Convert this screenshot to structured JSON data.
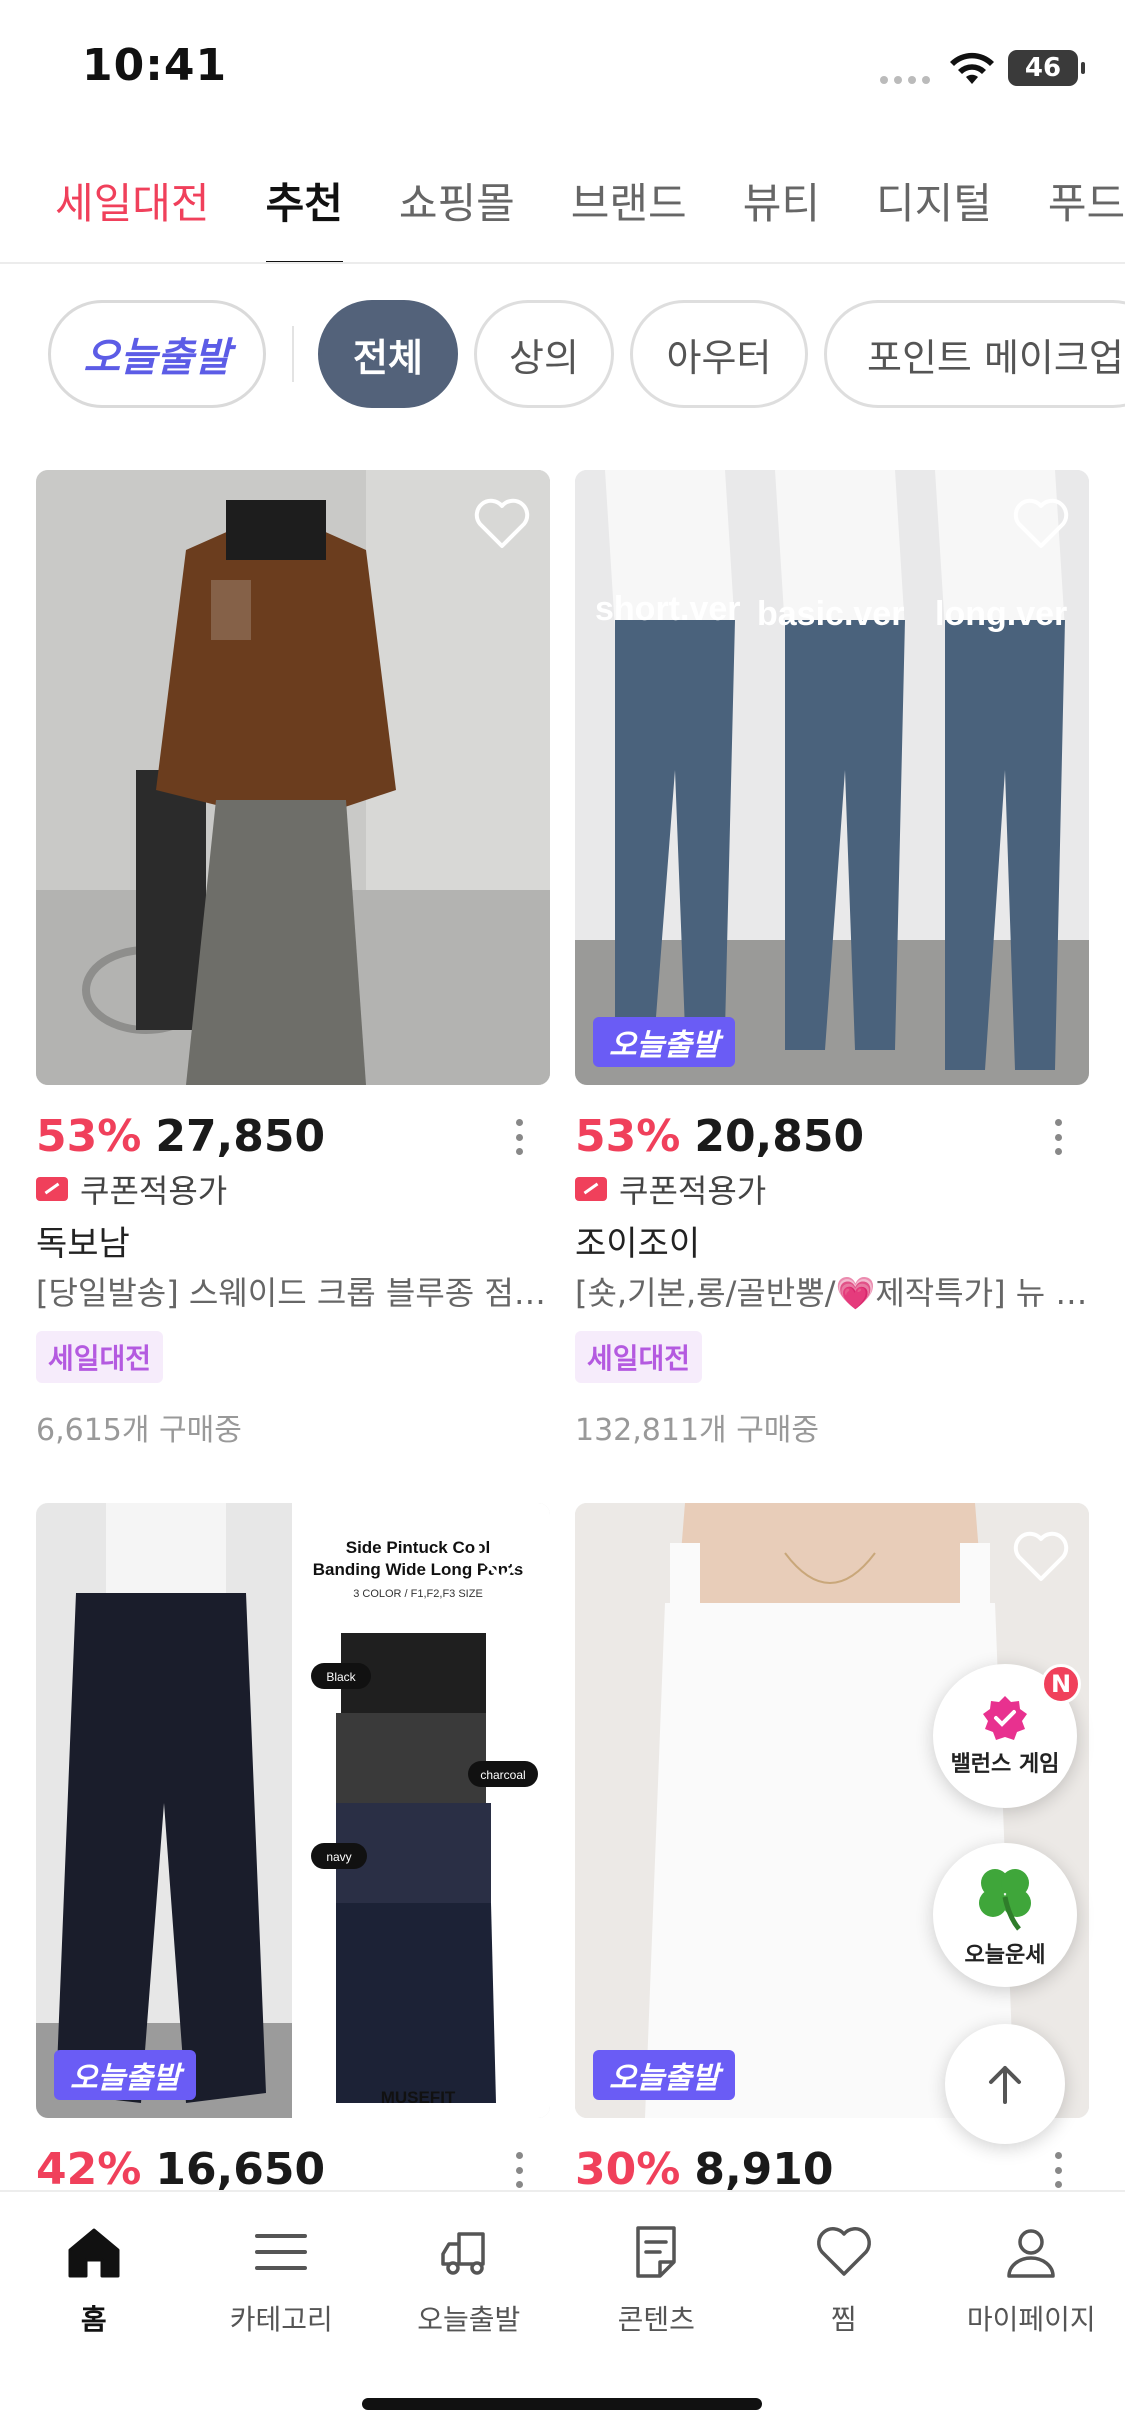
{
  "status_bar": {
    "time": "10:41",
    "battery": "46",
    "icons": [
      "signal-icon",
      "wifi-icon",
      "battery-icon"
    ]
  },
  "top_tabs": [
    {
      "label": "세일대전"
    },
    {
      "label": "추천"
    },
    {
      "label": "쇼핑몰"
    },
    {
      "label": "브랜드"
    },
    {
      "label": "뷰티"
    },
    {
      "label": "디지털"
    },
    {
      "label": "푸드"
    }
  ],
  "chips": {
    "today": "오늘출발",
    "items": [
      "전체",
      "상의",
      "아우터",
      "포인트 메이크업"
    ]
  },
  "products": [
    {
      "discount": "53%",
      "price": "27,850",
      "coupon": "쿠폰적용가",
      "brand": "독보남",
      "title": "[당일발송] 스웨이드 크롭 블루종 점퍼 자켓",
      "tag": "세일대전",
      "buyers": "6,615개 구매중",
      "badge": ""
    },
    {
      "discount": "53%",
      "price": "20,850",
      "coupon": "쿠폰적용가",
      "brand": "조이조이",
      "title": "[숏,기본,롱/골반뽕/💗제작특가] 뉴 부츠컷 데님",
      "tag": "세일대전",
      "buyers": "132,811개 구매중",
      "badge": "오늘출발",
      "image_text": [
        "short.ver",
        "basic.ver",
        "long.ver"
      ]
    },
    {
      "discount": "42%",
      "price": "16,650",
      "badge": "오늘출발",
      "image_text": [
        "Side Pintuck Cool",
        "Banding Wide Long Pants",
        "3 COLOR / F1,F2,F3 SIZE",
        "Black",
        "charcoal",
        "navy",
        "MUSEFIT"
      ]
    },
    {
      "discount": "30%",
      "price": "8,910",
      "badge": "오늘출발"
    }
  ],
  "floating": {
    "balance_game": "밸런스 게임",
    "balance_badge": "N",
    "fortune": "오늘운세"
  },
  "bottom_nav": [
    {
      "label": "홈",
      "icon": "home-icon"
    },
    {
      "label": "카테고리",
      "icon": "menu-icon"
    },
    {
      "label": "오늘출발",
      "icon": "truck-icon"
    },
    {
      "label": "콘텐츠",
      "icon": "document-icon"
    },
    {
      "label": "찜",
      "icon": "heart-icon"
    },
    {
      "label": "마이페이지",
      "icon": "person-icon"
    }
  ],
  "colors": {
    "accent": "#f0405b",
    "chip_active": "#53627a",
    "today_badge": "#6a5cf5",
    "sale_tag_bg": "#f6ecfb",
    "sale_tag_text": "#b45ae0"
  }
}
